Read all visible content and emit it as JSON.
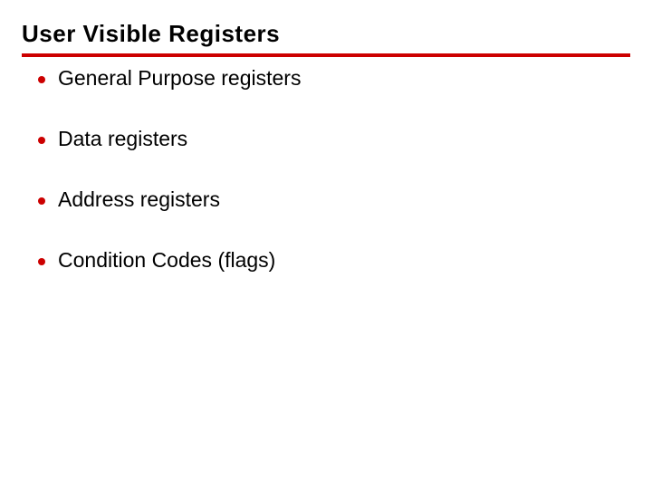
{
  "slide": {
    "title": "User Visible Registers",
    "items": [
      "General Purpose registers",
      "Data registers",
      "Address registers",
      "Condition Codes (flags)"
    ]
  }
}
